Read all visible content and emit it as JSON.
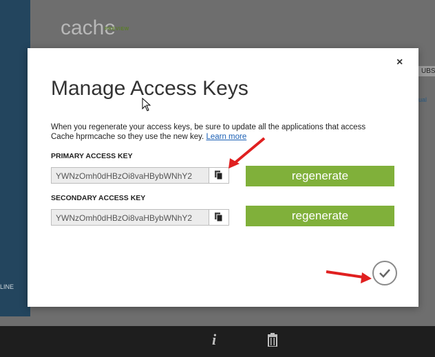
{
  "background": {
    "title": "cache",
    "badge": "PREVIEW",
    "right_text": "UBSC",
    "right_text2": "ual",
    "status_left": "LINE"
  },
  "modal": {
    "title": "Manage Access Keys",
    "close_label": "×",
    "description_prefix": "When you regenerate your access keys, be sure to update all the applications that access Cache hprmcache so they use the new key.",
    "learn_more": "Learn more",
    "primary": {
      "label": "PRIMARY ACCESS KEY",
      "value": "YWNzOmh0dHBzOi8vaHBybWNhY2",
      "regenerate_label": "regenerate"
    },
    "secondary": {
      "label": "SECONDARY ACCESS KEY",
      "value": "YWNzOmh0dHBzOi8vaHBybWNhY2",
      "regenerate_label": "regenerate"
    },
    "confirm_icon": "checkmark-icon"
  },
  "bottombar": {
    "icons": [
      "info-icon",
      "trash-icon"
    ]
  },
  "colors": {
    "accent_green": "#80b03a",
    "annotation_red": "#e02020",
    "link_blue": "#1a5fb4"
  }
}
